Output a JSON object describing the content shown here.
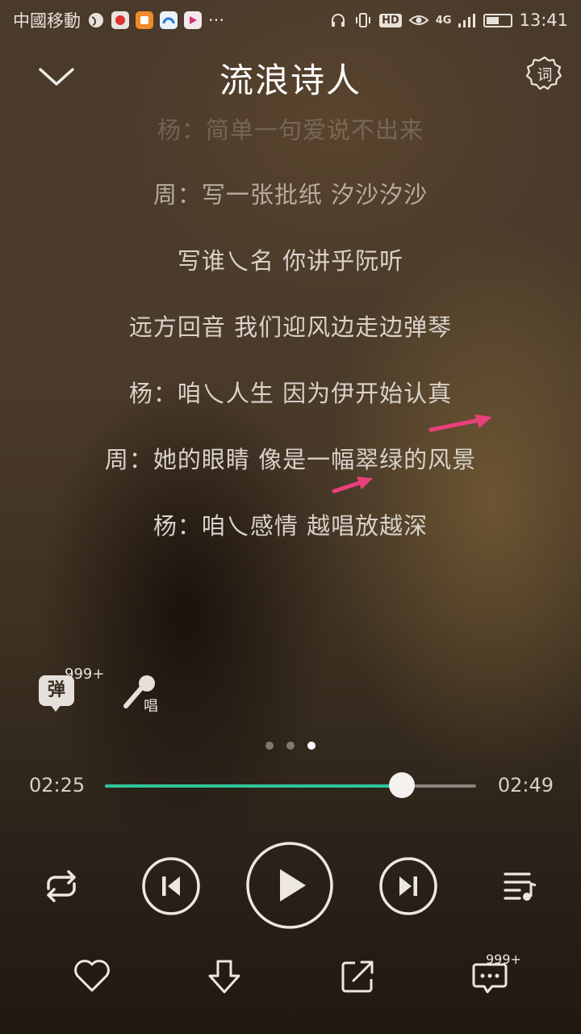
{
  "status_bar": {
    "carrier": "中國移動",
    "more": "···",
    "network": "4G",
    "hd": "HD",
    "time": "13:41",
    "battery_level": 0.55
  },
  "header": {
    "title": "流浪诗人",
    "lyrics_button_label": "词"
  },
  "lyrics": [
    {
      "text": "杨：简单一句爱说不出来",
      "state": "faded"
    },
    {
      "text": "周：写一张批纸 汐沙汐沙",
      "state": "dim"
    },
    {
      "text": "写谁乀名 你讲乎阮听",
      "state": "normal"
    },
    {
      "text": "远方回音 我们迎风边走边弹琴",
      "state": "normal"
    },
    {
      "text": "杨：咱乀人生 因为伊开始认真",
      "state": "normal"
    },
    {
      "text": "周：她的眼睛 像是一幅翠绿的风景",
      "state": "normal"
    },
    {
      "text": "杨：咱乀感情 越唱放越深",
      "state": "normal"
    }
  ],
  "actions": {
    "danmu_label": "弹",
    "danmu_count": "999+",
    "sing_label": "唱"
  },
  "pager": {
    "pages": 3,
    "active": 2
  },
  "playback": {
    "current_time": "02:25",
    "total_time": "02:49",
    "progress": 0.8
  },
  "bottom": {
    "comment_count": "999+"
  },
  "colors": {
    "accent": "#2fc49a",
    "annotation_arrow": "#e8407a"
  }
}
